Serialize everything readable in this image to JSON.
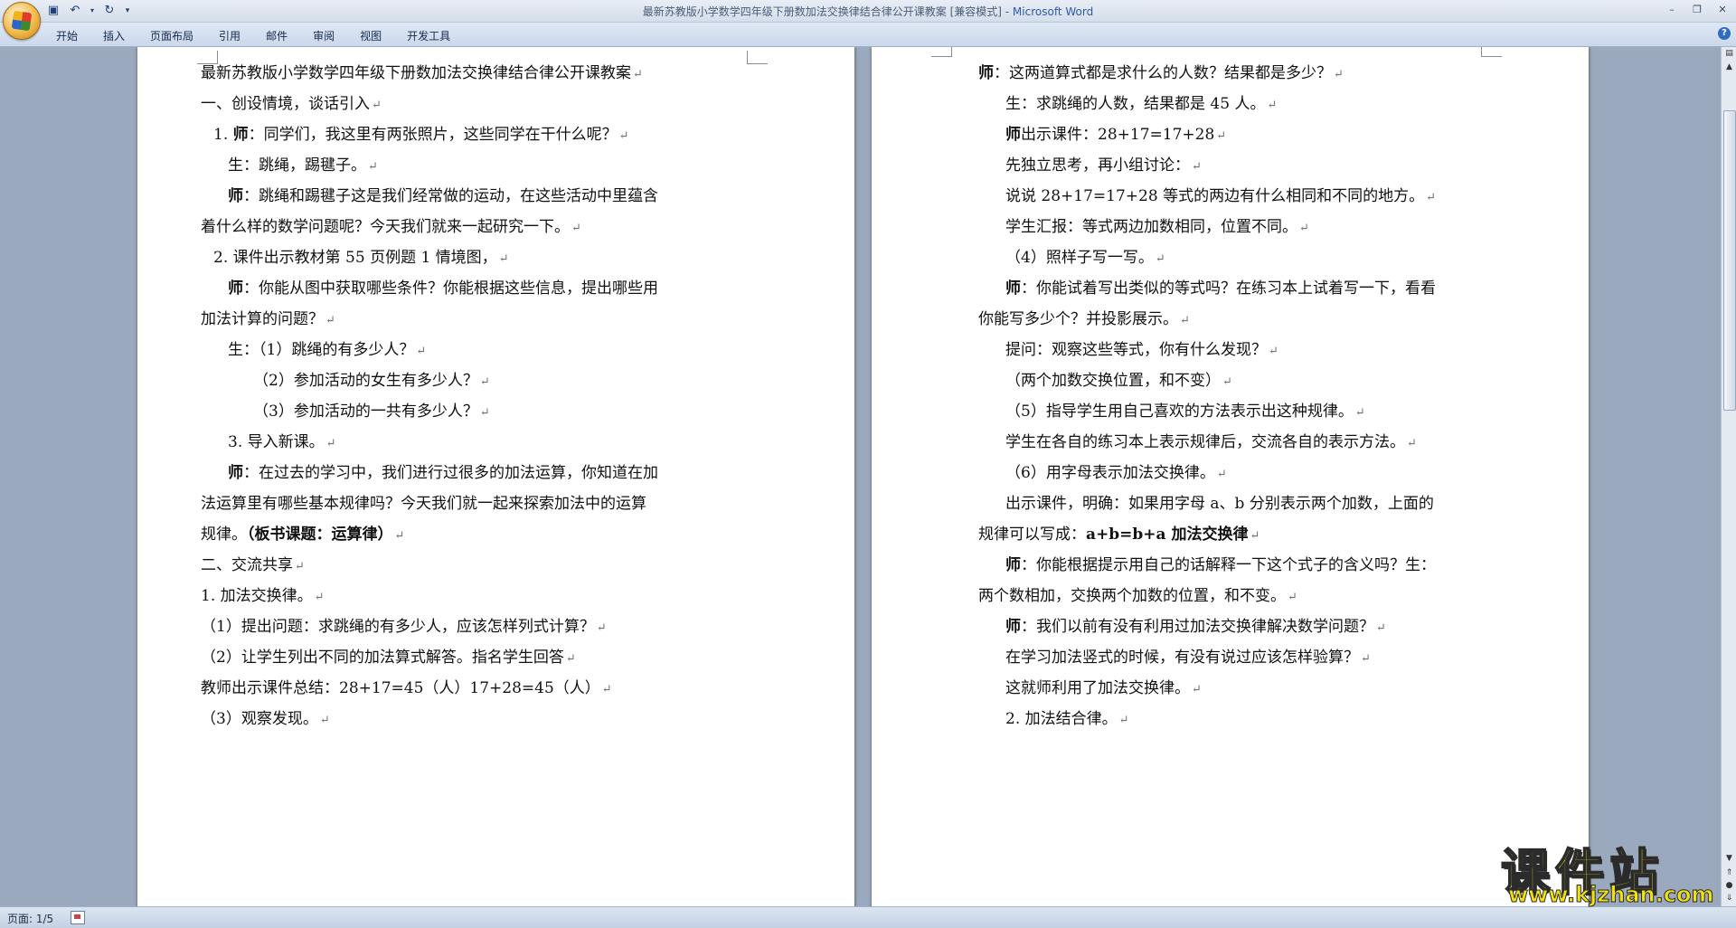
{
  "window": {
    "title": "最新苏教版小学数学四年级下册数加法交换律结合律公开课教案 [兼容模式] - ",
    "app_name": "Microsoft Word"
  },
  "quick_access": [
    "save-icon",
    "undo-icon",
    "dropdown-icon",
    "redo-icon",
    "customize-icon"
  ],
  "ribbon_tabs": [
    "开始",
    "插入",
    "页面布局",
    "引用",
    "邮件",
    "审阅",
    "视图",
    "开发工具"
  ],
  "status": {
    "page": "页面: 1/5"
  },
  "paragraph_mark": "↵",
  "left_page": [
    {
      "text": "最新苏教版小学数学四年级下册数加法交换律结合律公开课教案"
    },
    {
      "text": "一、创设情境，谈话引入"
    },
    {
      "prefix": "1. ",
      "bold": "师",
      "text": "：同学们，我这里有两张照片，这些同学在干什么呢？"
    },
    {
      "text": "生：跳绳，踢毽子。"
    },
    {
      "bold": "师",
      "text": "：跳绳和踢毽子这是我们经常做的运动，在这些活动中里蕴含",
      "nomark": true
    },
    {
      "text": "着什么样的数学问题呢？今天我们就来一起研究一下。"
    },
    {
      "text": "2. 课件出示教材第 55 页例题 1 情境图，"
    },
    {
      "bold": "师",
      "text": "：你能从图中获取哪些条件？你能根据这些信息，提出哪些用",
      "nomark": true
    },
    {
      "text": "加法计算的问题？"
    },
    {
      "text": "生：（1）跳绳的有多少人？"
    },
    {
      "text": "（2）参加活动的女生有多少人？"
    },
    {
      "text": "（3）参加活动的一共有多少人？"
    },
    {
      "text": "3. 导入新课。"
    },
    {
      "bold": "师",
      "text": "：在过去的学习中，我们进行过很多的加法运算，你知道在加",
      "nomark": true
    },
    {
      "text": "法运算里有哪些基本规律吗？今天我们就一起来探索加法中的运算",
      "nomark": true
    },
    {
      "text": "规律。",
      "bold_after": "（板书课题：运算律）"
    },
    {
      "text": "二、交流共享"
    },
    {
      "text": "1. 加法交换律。"
    },
    {
      "text": "（1）提出问题：求跳绳的有多少人，应该怎样列式计算？"
    },
    {
      "text": "（2）让学生列出不同的加法算式解答。指名学生回答"
    },
    {
      "text": "教师出示课件总结：28+17=45（人）17+28=45（人）"
    },
    {
      "text": "（3）观察发现。"
    }
  ],
  "right_page": [
    {
      "bold": "师",
      "text": "：这两道算式都是求什么的人数？结果都是多少？"
    },
    {
      "text": "生：求跳绳的人数，结果都是 45 人。"
    },
    {
      "bold": "师",
      "text": "出示课件：28+17=17+28"
    },
    {
      "text": "先独立思考，再小组讨论："
    },
    {
      "text": "说说 28+17=17+28 等式的两边有什么相同和不同的地方。"
    },
    {
      "text": "学生汇报：等式两边加数相同，位置不同。"
    },
    {
      "text": "（4）照样子写一写。"
    },
    {
      "bold": "师",
      "text": "：你能试着写出类似的等式吗？在练习本上试着写一下，看看",
      "nomark": true
    },
    {
      "text": "你能写多少个？并投影展示。"
    },
    {
      "text": "提问：观察这些等式，你有什么发现？"
    },
    {
      "text": "（两个加数交换位置，和不变）"
    },
    {
      "text": "（5）指导学生用自己喜欢的方法表示出这种规律。"
    },
    {
      "text": "学生在各自的练习本上表示规律后，交流各自的表示方法。"
    },
    {
      "text": "（6）用字母表示加法交换律。"
    },
    {
      "text": "出示课件，明确：如果用字母 a、b 分别表示两个加数，上面的",
      "nomark": true
    },
    {
      "text": "规律可以写成：",
      "bold_after": "a+b=b+a 加法交换律"
    },
    {
      "bold": "师",
      "text": "：你能根据提示用自己的话解释一下这个式子的含义吗？生：",
      "nomark": true
    },
    {
      "text": "两个数相加，交换两个加数的位置，和不变。"
    },
    {
      "bold": "师",
      "text": "：我们以前有没有利用过加法交换律解决数学问题？"
    },
    {
      "text": "在学习加法竖式的时候，有没有说过应该怎样验算？"
    },
    {
      "text": "这就师利用了加法交换律。"
    },
    {
      "text": "2. 加法结合律。"
    }
  ],
  "watermark": {
    "title": "课件站",
    "url": "www.kjzhan.com"
  }
}
